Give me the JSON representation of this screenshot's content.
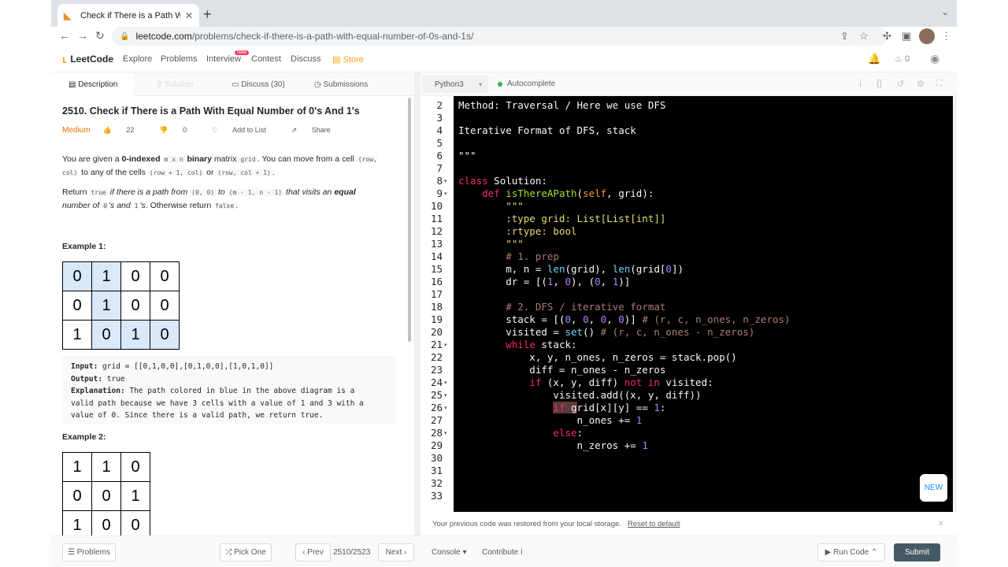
{
  "browser": {
    "tab_title": "Check if There is a Path With E",
    "url_host": "leetcode.com",
    "url_path": "/problems/check-if-there-is-a-path-with-equal-number-of-0s-and-1s/"
  },
  "nav": {
    "logo": "LeetCode",
    "items": [
      "Explore",
      "Problems",
      "Interview",
      "Contest",
      "Discuss",
      "Store"
    ],
    "interview_badge": "New",
    "fire_count": "0"
  },
  "left_tabs": [
    "Description",
    "Solution",
    "Discuss (30)",
    "Submissions"
  ],
  "problem": {
    "title": "2510. Check if There is a Path With Equal Number of 0's And 1's",
    "difficulty": "Medium",
    "likes": "22",
    "dislikes": "0",
    "add_to_list": "Add to List",
    "share": "Share",
    "p1_a": "You are given a ",
    "p1_b": "0-indexed",
    "p1_c": "m x n",
    "p1_d": "binary",
    "p1_e": " matrix ",
    "p1_f": "grid",
    "p1_g": ". You can move from a cell ",
    "p1_h": "(row, col)",
    "p1_i": " to any of the cells ",
    "p1_j": "(row + 1, col)",
    "p1_k": " or ",
    "p1_l": "(row, col + 1)",
    "p1_m": ".",
    "p2_a": "Return ",
    "p2_b": "true",
    "p2_c": " if there is a path from ",
    "p2_d": "(0, 0)",
    "p2_e": " to ",
    "p2_f": "(m - 1, n - 1)",
    "p2_g": " that visits an ",
    "p2_h": "equal",
    "p2_i": "number of ",
    "p2_j": "0",
    "p2_k": "'s and ",
    "p2_l": "1",
    "p2_m": "'s",
    "p2_n": ". Otherwise return ",
    "p2_o": "false",
    "p2_p": ".",
    "example1_heading": "Example 1:",
    "example2_heading": "Example 2:",
    "example1_grid": [
      [
        "0",
        "1",
        "0",
        "0"
      ],
      [
        "0",
        "1",
        "0",
        "0"
      ],
      [
        "1",
        "0",
        "1",
        "0"
      ]
    ],
    "example2_grid": [
      [
        "1",
        "1",
        "0"
      ],
      [
        "0",
        "0",
        "1"
      ],
      [
        "1",
        "0",
        "0"
      ]
    ],
    "input_label": "Input:",
    "input_value": " grid = [[0,1,0,0],[0,1,0,0],[1,0,1,0]]",
    "output_label": "Output:",
    "output_value": " true",
    "explanation_label": "Explanation:",
    "explanation_l1": " The path colored in blue in the above diagram is a",
    "explanation_l2": "valid path because we have 3 cells with a value of 1 and 3 with a",
    "explanation_l3": "value of 0. Since there is a valid path, we return true."
  },
  "editor_toolbar": {
    "language": "Python3",
    "autocomplete": "Autocomplete"
  },
  "editor": {
    "line_numbers": [
      "2",
      "3",
      "4",
      "5",
      "6",
      "7",
      "8",
      "9",
      "10",
      "11",
      "12",
      "13",
      "14",
      "15",
      "16",
      "17",
      "18",
      "19",
      "20",
      "21",
      "22",
      "23",
      "24",
      "25",
      "26",
      "27",
      "28",
      "29",
      "30",
      "31",
      "32",
      "33"
    ],
    "fold_lines": [
      "8",
      "9",
      "21",
      "24",
      "25",
      "26",
      "28"
    ]
  },
  "restore": {
    "message": "Your previous code was restored from your local storage.",
    "reset": "Reset to default"
  },
  "new_button": "NEW",
  "bottom": {
    "problems": "Problems",
    "pick_one": "Pick One",
    "prev": "Prev",
    "count": "2510/2523",
    "next": "Next",
    "console": "Console",
    "contribute": "Contribute",
    "run_code": "Run Code",
    "submit": "Submit"
  }
}
